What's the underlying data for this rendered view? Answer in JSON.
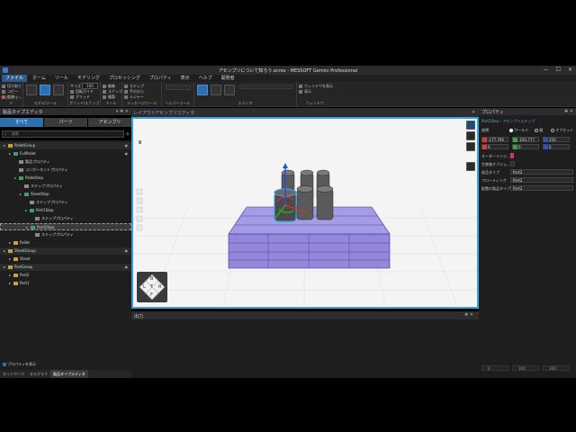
{
  "window": {
    "title": "アセンブリについて知ろう.ecrex - MESSOFT Gemini Professional",
    "buttons": [
      "—",
      "☐",
      "✕"
    ]
  },
  "menubar": {
    "tabs": [
      {
        "label": "ファイル",
        "active": true
      },
      {
        "label": "ホーム",
        "active": false
      },
      {
        "label": "ツール",
        "active": false
      },
      {
        "label": "モデリング",
        "active": false
      },
      {
        "label": "プロセッシング",
        "active": false
      },
      {
        "label": "プロパティ",
        "active": false
      },
      {
        "label": "表示",
        "active": false
      },
      {
        "label": "ヘルプ",
        "active": false
      },
      {
        "label": "開発者",
        "active": false
      }
    ]
  },
  "ribbon": {
    "groups": [
      {
        "label": "クリップボード"
      },
      {
        "label": "モデル/ツール"
      },
      {
        "label": "グリッド/スナップ"
      },
      {
        "label": "ツール"
      },
      {
        "label": "メッセージ/ツール"
      },
      {
        "label": "ヘルパーツール"
      },
      {
        "label": "エディタ"
      },
      {
        "label": "ウィンドウ"
      }
    ],
    "small": {
      "cut": "切り取り",
      "copy": "コピー",
      "delete": "削除",
      "size": "サイズ",
      "size_value": "100",
      "angle": "回転ガイド",
      "snap": "スナップ",
      "grid": "グリッド",
      "edit": "編集",
      "duplicate": "複製",
      "step": "ステップ",
      "hand": "手のひら",
      "measure": "メジャー",
      "window1": "ウィンドウを表示",
      "window2": "表示"
    }
  },
  "left_panel": {
    "title": "製品タイプエディタ",
    "tabs": [
      {
        "label": "すべて",
        "active": true
      },
      {
        "label": "パーツ",
        "active": false
      },
      {
        "label": "アセンブリ",
        "active": false
      }
    ],
    "search_placeholder": "検索",
    "tree": [
      {
        "label": "PalletGroup",
        "indent": 0,
        "icon": "folder",
        "color": "#c8a040",
        "group": true,
        "eye": true
      },
      {
        "label": "FullPallet",
        "indent": 1,
        "icon": "assembly",
        "color": "#40a060",
        "eye": true
      },
      {
        "label": "製品プロパティ",
        "indent": 2,
        "icon": "prop",
        "color": "#8a8a8a"
      },
      {
        "label": "コンポーネントプロパティ",
        "indent": 2,
        "icon": "prop",
        "color": "#8a8a8a"
      },
      {
        "label": "PalletStep",
        "indent": 2,
        "icon": "step",
        "color": "#40a060"
      },
      {
        "label": "ステッププロパティ",
        "indent": 3,
        "icon": "prop",
        "color": "#8a8a8a"
      },
      {
        "label": "SheetStep",
        "indent": 3,
        "icon": "step",
        "color": "#40a060"
      },
      {
        "label": "ステッププロパティ",
        "indent": 4,
        "icon": "prop",
        "color": "#8a8a8a"
      },
      {
        "label": "Part1Step",
        "indent": 4,
        "icon": "step",
        "color": "#40a060"
      },
      {
        "label": "ステッププロパティ",
        "indent": 5,
        "icon": "prop",
        "color": "#8a8a8a"
      },
      {
        "label": "Part2Step",
        "indent": 4,
        "icon": "step",
        "color": "#40a060",
        "selected": true
      },
      {
        "label": "ステッププロパティ",
        "indent": 5,
        "icon": "prop",
        "color": "#8a8a8a"
      },
      {
        "label": "Pallet",
        "indent": 1,
        "icon": "part",
        "color": "#c8a040"
      },
      {
        "label": "SheetGroup",
        "indent": 0,
        "icon": "folder",
        "color": "#c8a040",
        "group": true,
        "eye": true
      },
      {
        "label": "Sheet",
        "indent": 1,
        "icon": "part",
        "color": "#c8a040"
      },
      {
        "label": "PartGroup",
        "indent": 0,
        "icon": "folder",
        "color": "#c8a040",
        "group": true,
        "eye": true
      },
      {
        "label": "Part2",
        "indent": 1,
        "icon": "part",
        "color": "#c8a040"
      },
      {
        "label": "Part1",
        "indent": 1,
        "icon": "part",
        "color": "#c8a040"
      }
    ],
    "footer_checkbox": "プロパティを表示",
    "bottom_tabs": [
      {
        "label": "ネットワーク",
        "active": false
      },
      {
        "label": "セルグラフ",
        "active": false
      },
      {
        "label": "製品タイプエディタ",
        "active": true
      }
    ]
  },
  "viewport": {
    "tabs": [
      "レイアウト",
      "アセンブリエディタ"
    ],
    "cube_labels": {
      "top": "B",
      "left": "L",
      "front": "F",
      "right": "R",
      "center": "T"
    }
  },
  "output": {
    "title": "出力"
  },
  "right_panel": {
    "title": "プロパティ",
    "breadcrumb": "Part2Step - アセンブリステップ",
    "coord_label": "座標",
    "coord_options": [
      {
        "label": "ワールド",
        "selected": true
      },
      {
        "label": "親",
        "selected": false
      },
      {
        "label": "オフセット",
        "selected": false
      }
    ],
    "position": [
      {
        "axis": "X",
        "value": "-177.795",
        "color": "#d04030"
      },
      {
        "axis": "Y",
        "value": "-193.777",
        "color": "#40a040"
      },
      {
        "axis": "Z",
        "value": "250",
        "color": "#3050d0"
      }
    ],
    "rotation": [
      {
        "axis": "X",
        "value": "0",
        "color": "#d04030"
      },
      {
        "axis": "Y",
        "value": "0",
        "color": "#40a040"
      },
      {
        "axis": "Z",
        "value": "0",
        "color": "#3050d0"
      }
    ],
    "rows": [
      {
        "label": "オーダーインジ...",
        "value": ""
      },
      {
        "label": "生産後オブジェ...",
        "value": ""
      },
      {
        "label": "部品タイプ",
        "value": "Part2"
      },
      {
        "label": "フローティング",
        "value": "Part2"
      },
      {
        "label": "配置の製品タイプ",
        "value": "Part2"
      }
    ],
    "bottom_values": [
      "0",
      "100",
      "100"
    ]
  },
  "colors": {
    "accent": "#3aa0d8",
    "pallet": "#6a5acd",
    "cylinder": "#555555"
  }
}
